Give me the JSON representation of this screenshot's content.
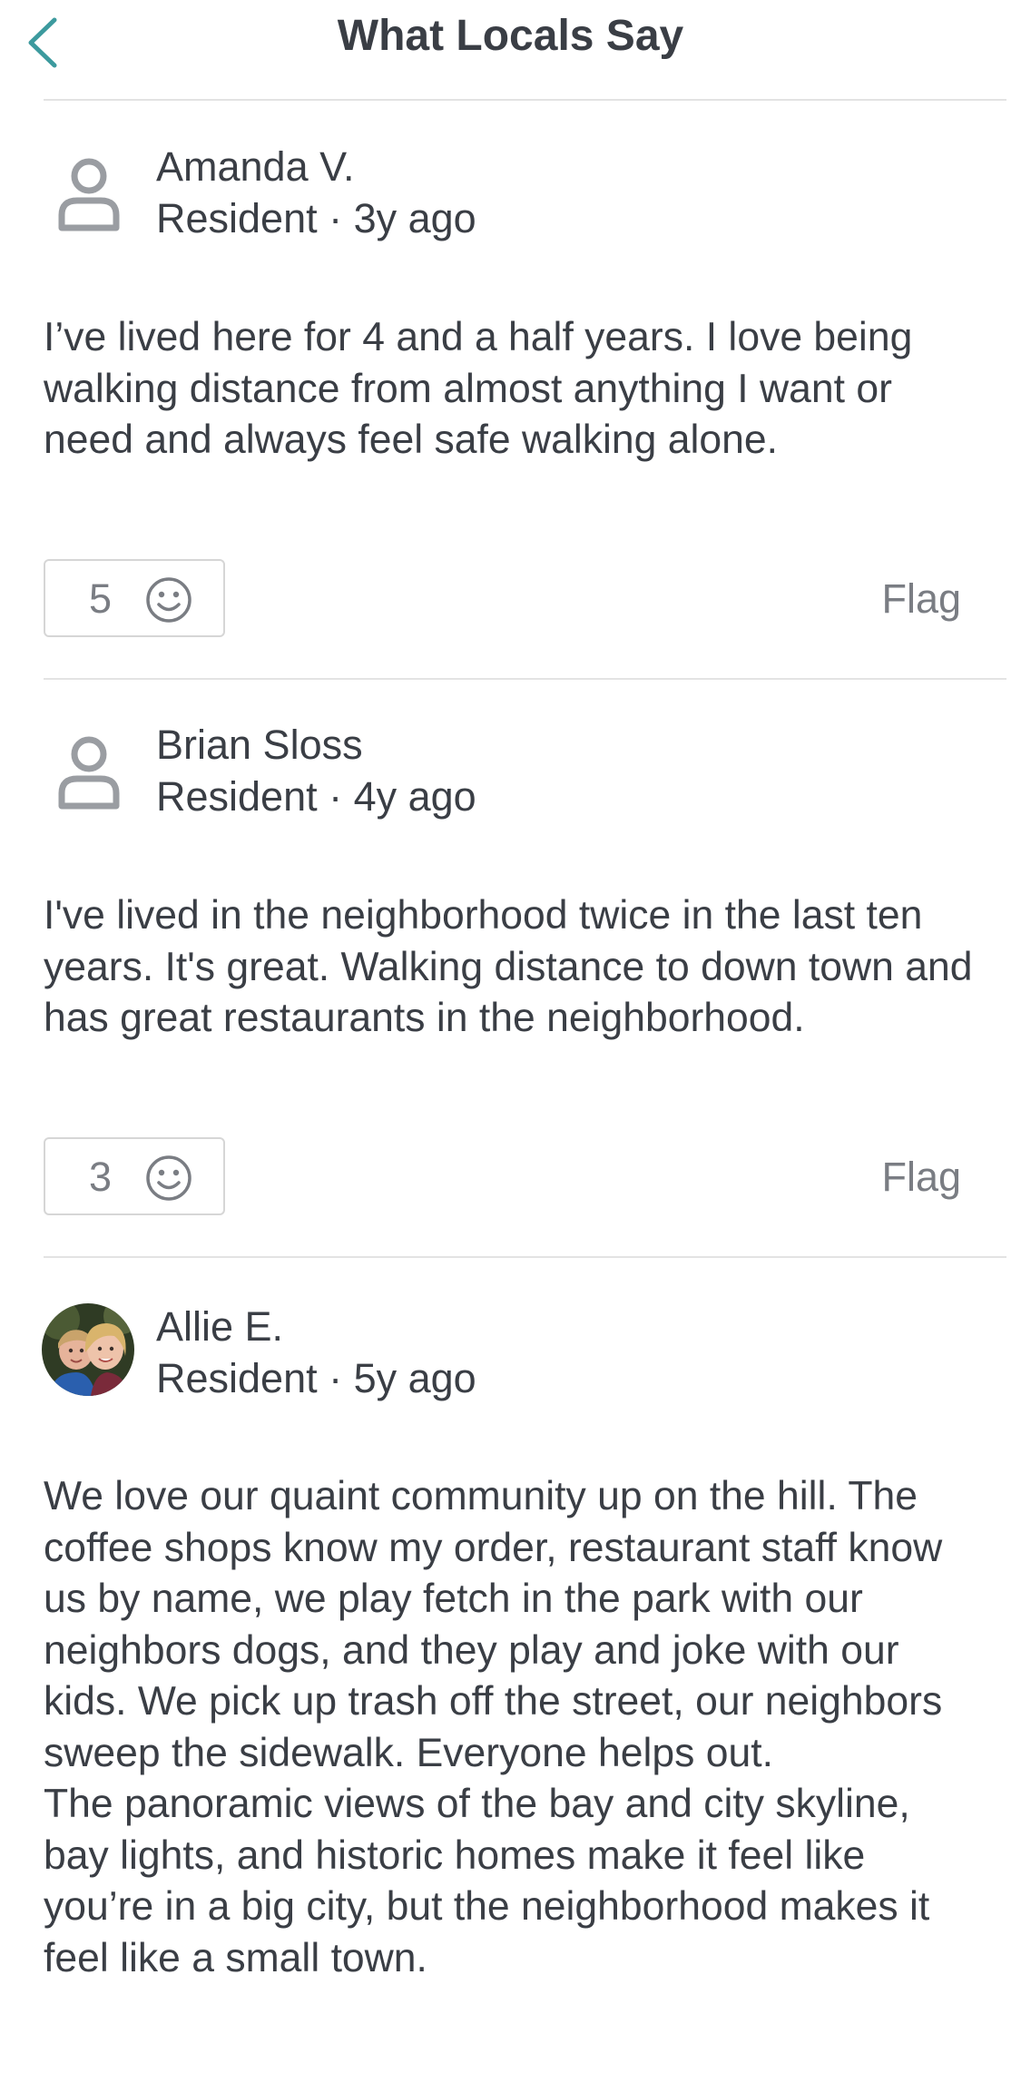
{
  "header": {
    "title": "What Locals Say",
    "back_icon": "chevron-left-icon",
    "accent_color": "#3c9a9e"
  },
  "reviews": [
    {
      "author": "Amanda V.",
      "meta": "Resident · 3y ago",
      "avatar": "person-icon",
      "body": [
        "I’ve lived here for 4 and a half years. I love being walking distance from almost anything I want or need and always feel safe walking alone."
      ],
      "reaction_count": "5",
      "reaction_icon": "smiley-icon",
      "flag_label": "Flag"
    },
    {
      "author": "Brian Sloss",
      "meta": "Resident · 4y ago",
      "avatar": "person-icon",
      "body": [
        "I've lived in the neighborhood twice in the last ten years. It's great. Walking distance to down town and has great restaurants in the neighborhood."
      ],
      "reaction_count": "3",
      "reaction_icon": "smiley-icon",
      "flag_label": "Flag"
    },
    {
      "author": "Allie E.",
      "meta": "Resident · 5y ago",
      "avatar": "avatar-photo",
      "body": [
        "We love our quaint community up on the hill. The coffee shops know my order, restaurant staff know us by name, we play fetch in the park with our neighbors dogs, and they play and joke with our kids. We pick up trash off the street, our neighbors sweep the sidewalk. Everyone helps out.",
        "The panoramic views of the bay and city skyline, bay lights, and historic homes make it feel like you’re in a big city, but the neighborhood makes it feel like a small town."
      ]
    }
  ]
}
